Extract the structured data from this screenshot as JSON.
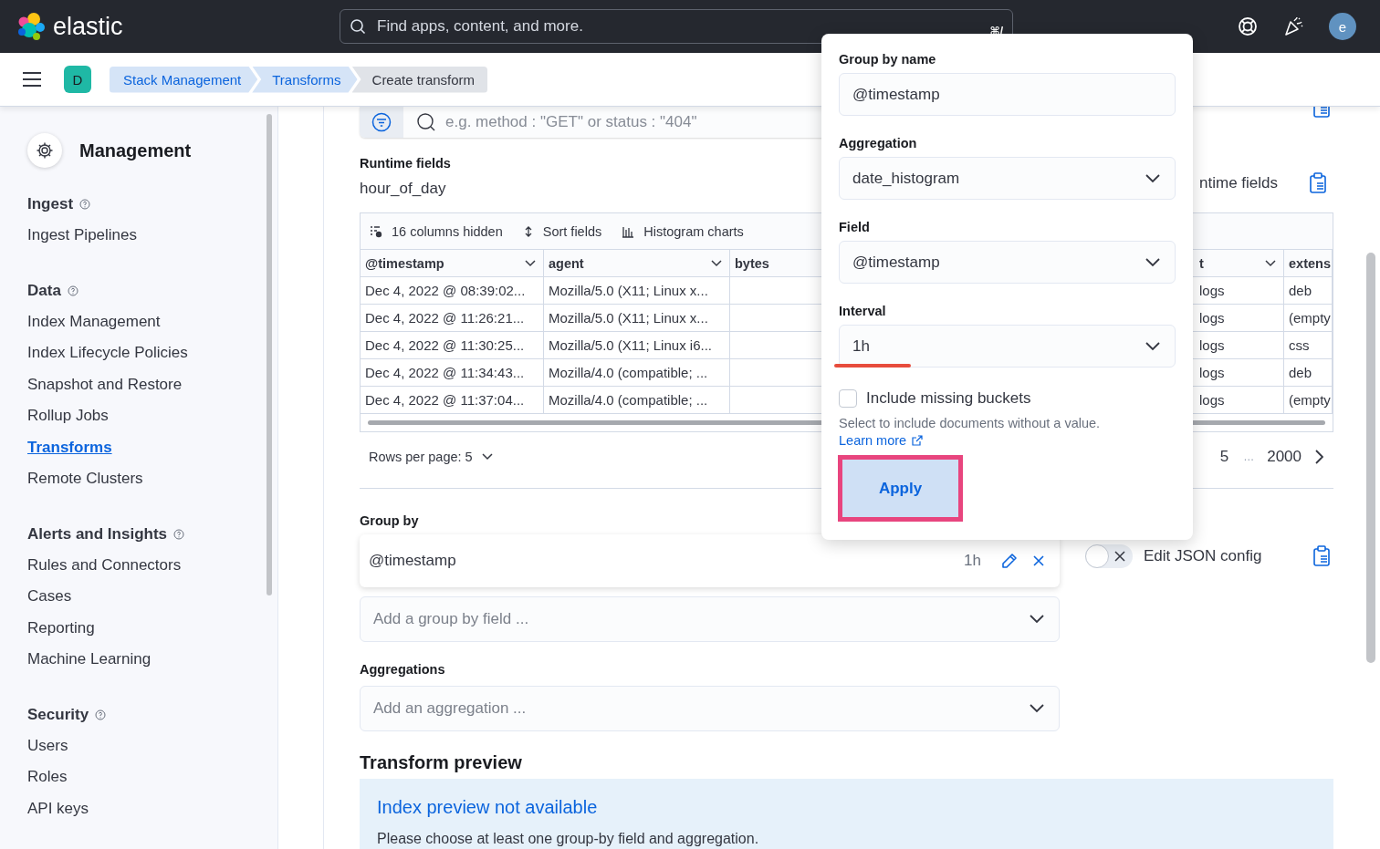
{
  "header": {
    "logo_text": "elastic",
    "search": {
      "placeholder": "Find apps, content, and more.",
      "shortcut": "⌘/"
    },
    "avatar": "e"
  },
  "breadcrumbs": {
    "space": "D",
    "items": [
      {
        "label": "Stack Management",
        "kind": "link"
      },
      {
        "label": "Transforms",
        "kind": "link"
      },
      {
        "label": "Create transform",
        "kind": "current"
      }
    ]
  },
  "sidebar": {
    "title": "Management",
    "sections": [
      {
        "title": "Ingest",
        "items": [
          {
            "label": "Ingest Pipelines",
            "selected": false
          }
        ]
      },
      {
        "title": "Data",
        "items": [
          {
            "label": "Index Management",
            "selected": false
          },
          {
            "label": "Index Lifecycle Policies",
            "selected": false
          },
          {
            "label": "Snapshot and Restore",
            "selected": false
          },
          {
            "label": "Rollup Jobs",
            "selected": false
          },
          {
            "label": "Transforms",
            "selected": true
          },
          {
            "label": "Remote Clusters",
            "selected": false
          }
        ]
      },
      {
        "title": "Alerts and Insights",
        "items": [
          {
            "label": "Rules and Connectors",
            "selected": false
          },
          {
            "label": "Cases",
            "selected": false
          },
          {
            "label": "Reporting",
            "selected": false
          },
          {
            "label": "Machine Learning",
            "selected": false
          }
        ]
      },
      {
        "title": "Security",
        "items": [
          {
            "label": "Users",
            "selected": false
          },
          {
            "label": "Roles",
            "selected": false
          },
          {
            "label": "API keys",
            "selected": false
          }
        ]
      }
    ]
  },
  "query_bar": {
    "placeholder": "e.g. method : \"GET\" or status : \"404\""
  },
  "runtime_fields": {
    "label": "Runtime fields",
    "value": "hour_of_day",
    "switch_label": "ntime fields"
  },
  "table": {
    "toolbar": [
      "16 columns hidden",
      "Sort fields",
      "Histogram charts"
    ],
    "columns": [
      {
        "label": "@timestamp",
        "menu": true
      },
      {
        "label": "agent",
        "menu": true
      },
      {
        "label": "bytes"
      },
      {
        "label": "t",
        "menu": true
      },
      {
        "label": "extens"
      }
    ],
    "rows": [
      [
        "Dec 4, 2022 @ 08:39:02...",
        "Mozilla/5.0 (X11; Linux x...",
        null,
        "logs",
        "deb"
      ],
      [
        "Dec 4, 2022 @ 11:26:21...",
        "Mozilla/5.0 (X11; Linux x...",
        null,
        "logs",
        "(empty"
      ],
      [
        "Dec 4, 2022 @ 11:30:25...",
        "Mozilla/5.0 (X11; Linux i6...",
        null,
        "logs",
        "css"
      ],
      [
        "Dec 4, 2022 @ 11:34:43...",
        "Mozilla/4.0 (compatible; ...",
        null,
        "logs",
        "deb"
      ],
      [
        "Dec 4, 2022 @ 11:37:04...",
        "Mozilla/4.0 (compatible; ...",
        null,
        "logs",
        "(empty"
      ]
    ]
  },
  "pagination": {
    "rows_per_page": "Rows per page: 5",
    "pages": [
      "5",
      "…",
      "2000"
    ]
  },
  "group_by": {
    "label": "Group by",
    "items": [
      {
        "name": "@timestamp",
        "interval": "1h"
      }
    ],
    "add_placeholder": "Add a group by field ..."
  },
  "json_config": {
    "label": "Edit JSON config",
    "on": false
  },
  "aggregations": {
    "label": "Aggregations",
    "placeholder": "Add an aggregation ..."
  },
  "transform_preview": {
    "title": "Transform preview",
    "callout_title": "Index preview not available",
    "callout_text": "Please choose at least one group-by field and aggregation."
  },
  "popover": {
    "fields": [
      {
        "label": "Group by name",
        "value": "@timestamp",
        "kind": "text",
        "marked": false
      },
      {
        "label": "Aggregation",
        "value": "date_histogram",
        "kind": "select",
        "marked": false
      },
      {
        "label": "Field",
        "value": "@timestamp",
        "kind": "select",
        "marked": false
      },
      {
        "label": "Interval",
        "value": "1h",
        "kind": "select",
        "marked": true
      }
    ],
    "checkbox": {
      "label": "Include missing buckets",
      "checked": false
    },
    "help": "Select to include documents without a value.",
    "link": "Learn more",
    "button": "Apply",
    "button_highlighted": true
  }
}
